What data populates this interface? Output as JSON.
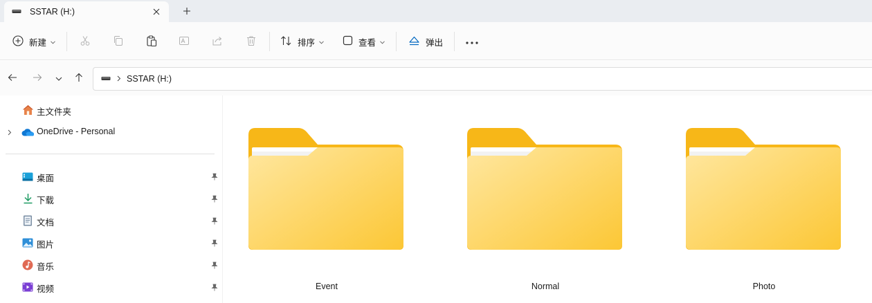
{
  "window": {
    "tab_title": "SSTAR (H:)",
    "tab_icon": "drive-icon",
    "close_icon": "close-icon",
    "new_tab_icon": "plus-icon"
  },
  "toolbar": {
    "new_label": "新建",
    "sort_label": "排序",
    "view_label": "查看",
    "eject_label": "弹出",
    "icons": [
      "new-icon",
      "cut-icon",
      "copy-icon",
      "paste-icon",
      "rename-icon",
      "share-icon",
      "delete-icon",
      "sort-icon",
      "view-icon",
      "eject-icon",
      "more-icon"
    ]
  },
  "address": {
    "breadcrumb": [
      "SSTAR (H:)"
    ]
  },
  "sidebar": {
    "top_items": [
      {
        "label": "主文件夹",
        "icon": "home-icon"
      },
      {
        "label": "OneDrive - Personal",
        "icon": "onedrive-cloud-icon"
      }
    ],
    "quick_access": [
      {
        "label": "桌面",
        "icon": "desktop-icon"
      },
      {
        "label": "下载",
        "icon": "download-icon"
      },
      {
        "label": "文档",
        "icon": "document-icon"
      },
      {
        "label": "图片",
        "icon": "pictures-icon"
      },
      {
        "label": "音乐",
        "icon": "music-icon"
      },
      {
        "label": "视频",
        "icon": "videos-icon"
      }
    ]
  },
  "content": {
    "folders": [
      {
        "name": "Event"
      },
      {
        "name": "Normal"
      },
      {
        "name": "Photo"
      }
    ]
  },
  "colors": {
    "accent": "#0067c0",
    "folder_front_light": "#ffe289",
    "folder_front_dark": "#fcc735",
    "folder_back": "#f7b718"
  }
}
